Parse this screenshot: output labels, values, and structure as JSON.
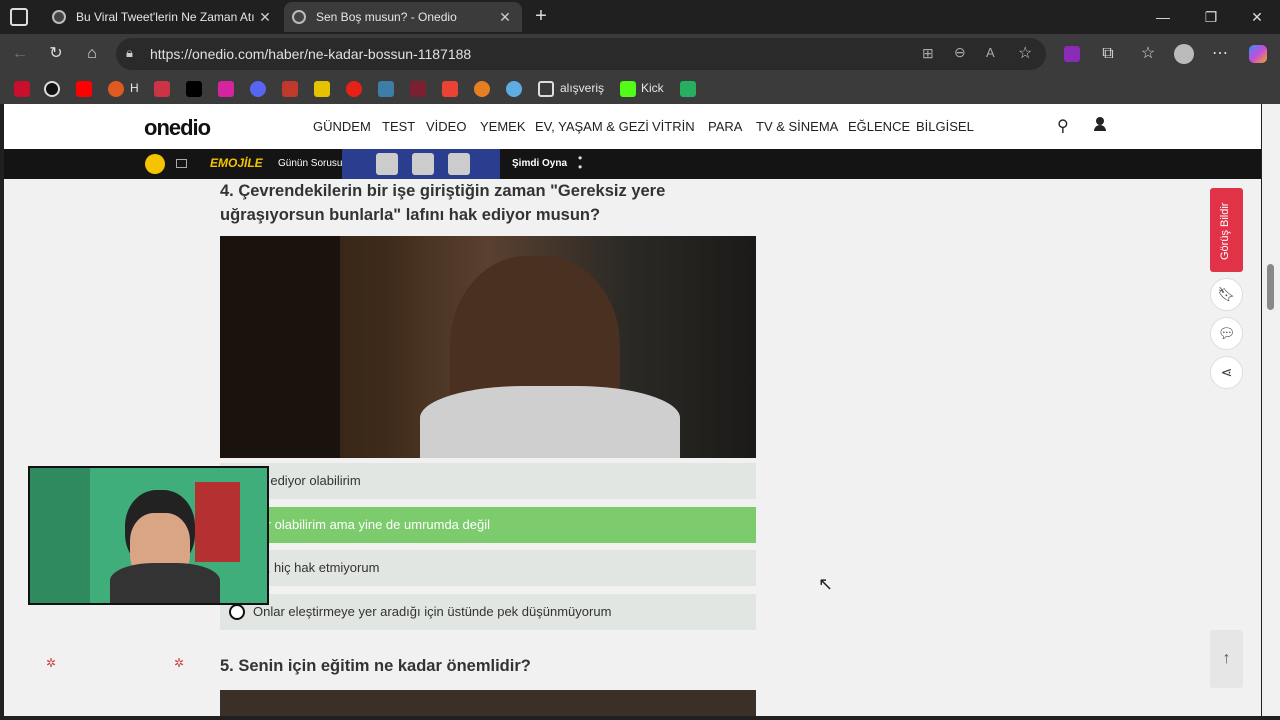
{
  "tabs": [
    {
      "title": "Bu Viral Tweet'lerin Ne Zaman Atı",
      "active": false
    },
    {
      "title": "Sen Boş musun? - Onedio",
      "active": true
    }
  ],
  "address": {
    "url": "https://onedio.com/haber/ne-kadar-bossun-1187188"
  },
  "bookmarks": {
    "h_label": "H",
    "folder_label": "alışveriş",
    "kick_label": "Kick"
  },
  "site": {
    "logo": "onedio",
    "nav": [
      "GÜNDEM",
      "TEST",
      "VİDEO",
      "YEMEK",
      "EV, YAŞAM & GEZİ",
      "VİTRİN",
      "PARA",
      "TV & SİNEMA",
      "EĞLENCE",
      "BİLGİSEL"
    ],
    "gamebar": {
      "brand": "EMOJİLE",
      "subtitle": "Günün Sorusu",
      "play": "Şimdi Oyna"
    }
  },
  "question4": {
    "title": "4. Çevrendekilerin bir işe giriştiğin zaman \"Gereksiz yere uğraşıyorsun bunlarla\" lafını hak ediyor musun?",
    "options": [
      {
        "label": "az ediyor olabilirim",
        "selected": false
      },
      {
        "label": "yor olabilirim ama yine de umrumda değil",
        "selected": true
      },
      {
        "label": "yır, hiç hak etmiyorum",
        "selected": false
      },
      {
        "label": "Onlar eleştirmeye yer aradığı için üstünde pek düşünmüyorum",
        "selected": false
      }
    ]
  },
  "question5": {
    "title": "5. Senin için eğitim ne kadar önemlidir?"
  },
  "sidebar": {
    "feedback_label": "Görüş Bildir"
  },
  "colors": {
    "selected_option": "#7ccb6d",
    "feedback": "#e03348"
  }
}
